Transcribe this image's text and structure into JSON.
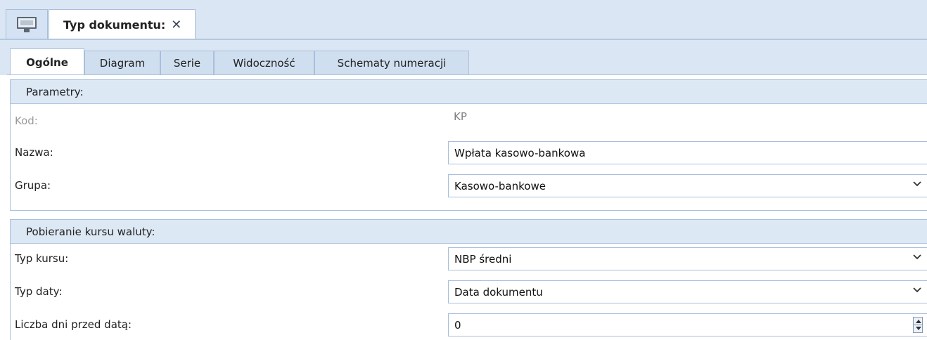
{
  "document_tab": {
    "title": "Typ dokumentu:",
    "close_icon": "close-icon",
    "home_icon": "monitor-icon"
  },
  "tabs": [
    {
      "label": "Ogólne",
      "active": true
    },
    {
      "label": "Diagram",
      "active": false
    },
    {
      "label": "Serie",
      "active": false
    },
    {
      "label": "Widoczność",
      "active": false
    },
    {
      "label": "Schematy numeracji",
      "active": false
    }
  ],
  "parametry": {
    "header": "Parametry:",
    "kod": {
      "label": "Kod:",
      "value": "KP"
    },
    "nazwa": {
      "label": "Nazwa:",
      "value": "Wpłata kasowo-bankowa"
    },
    "grupa": {
      "label": "Grupa:",
      "value": "Kasowo-bankowe"
    }
  },
  "kurs": {
    "header": "Pobieranie kursu waluty:",
    "typ_kursu": {
      "label": "Typ kursu:",
      "value": "NBP średni"
    },
    "typ_daty": {
      "label": "Typ daty:",
      "value": "Data dokumentu"
    },
    "liczba_dni": {
      "label": "Liczba dni przed datą:",
      "value": "0"
    }
  },
  "colors": {
    "accent": "#dbe6f4",
    "border": "#a8bfdc",
    "disabled_text": "#9a9a9a"
  }
}
